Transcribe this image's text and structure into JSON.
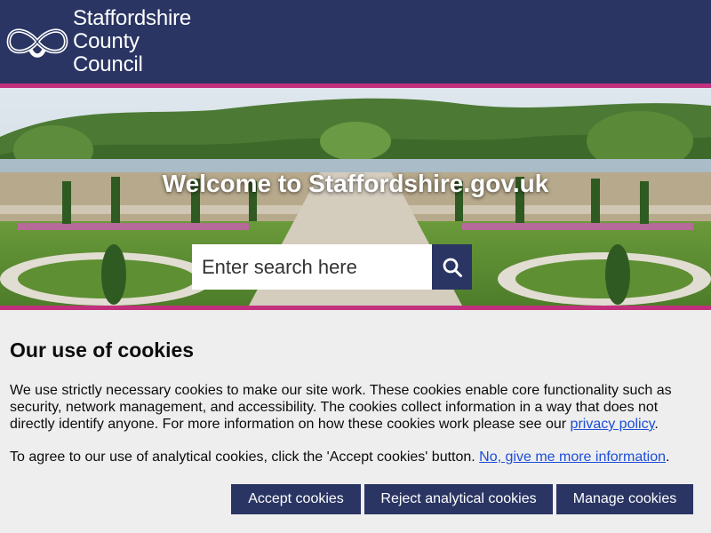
{
  "header": {
    "logo_line1": "Staffordshire",
    "logo_line2": "County Council",
    "logo_icon": "staffordshire-knot-icon"
  },
  "hero": {
    "title": "Welcome to Staffordshire.gov.uk",
    "search_placeholder": "Enter search here",
    "search_icon": "search-icon"
  },
  "cookies": {
    "heading": "Our use of cookies",
    "para1_text": "We use strictly necessary cookies to make our site work. These cookies enable core functionality such as security, network management, and accessibility. The cookies collect information in a way that does not directly identify anyone. For more information on how these cookies work please see our ",
    "para1_link": "privacy policy",
    "para1_end": ".",
    "para2_text": "To agree to our use of analytical cookies, click the 'Accept cookies' button. ",
    "para2_link": "No, give me more information",
    "para2_end": ".",
    "accept_label": "Accept cookies",
    "reject_label": "Reject analytical cookies",
    "manage_label": "Manage cookies"
  },
  "colors": {
    "brand_navy": "#2a3563",
    "accent_magenta": "#c2307d",
    "link_blue": "#1d4ed8"
  }
}
